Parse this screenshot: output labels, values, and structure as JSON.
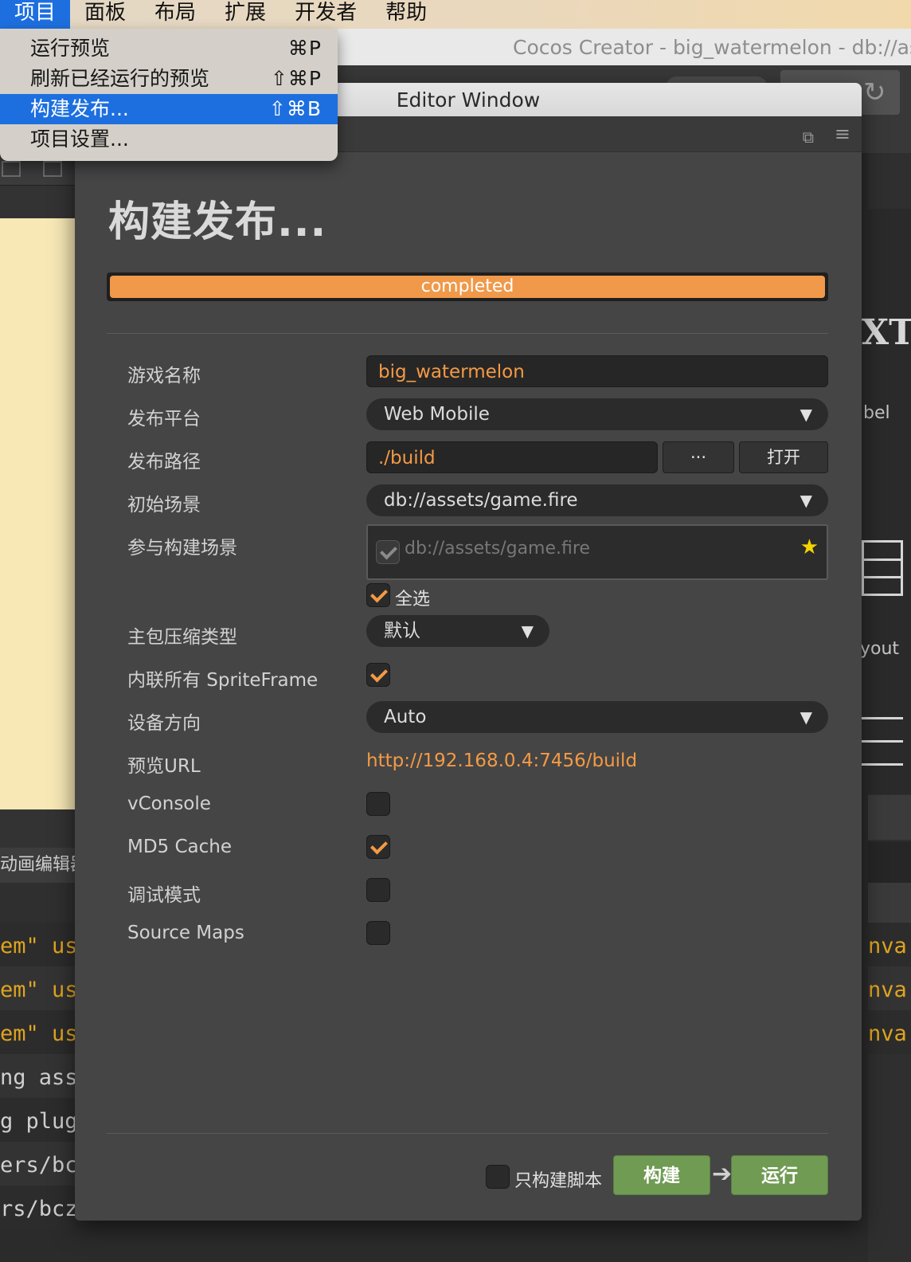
{
  "menubar": {
    "items": [
      "项目",
      "面板",
      "布局",
      "扩展",
      "开发者",
      "帮助"
    ],
    "active_index": 0
  },
  "dropdown": {
    "items": [
      {
        "label": "运行预览",
        "shortcut": "⌘P"
      },
      {
        "label": "刷新已经运行的预览",
        "shortcut": "⇧⌘P"
      },
      {
        "label": "构建发布...",
        "shortcut": "⇧⌘B"
      },
      {
        "label": "项目设置...",
        "shortcut": ""
      }
    ],
    "active_index": 2
  },
  "background": {
    "app_title": "Cocos Creator - big_watermelon - db://as",
    "anim_tab": "动画编辑器",
    "console_left": [
      "em\" us",
      "em\" us",
      "em\" us",
      "ng ass",
      "g plug",
      "ers/bc",
      "rs/bcz"
    ],
    "console_right": [
      "nva",
      "nva",
      "nva"
    ],
    "right_labels": {
      "xt": "XT",
      "label": "bel",
      "layout": "yout"
    }
  },
  "window": {
    "title": "Editor Window",
    "heading": "构建发布...",
    "progress": {
      "label": "completed",
      "percent": 100
    },
    "fields": {
      "game_name": {
        "label": "游戏名称",
        "value": "big_watermelon"
      },
      "platform": {
        "label": "发布平台",
        "value": "Web Mobile"
      },
      "build_path": {
        "label": "发布路径",
        "value": "./build",
        "browse": "···",
        "open": "打开"
      },
      "start_scene": {
        "label": "初始场景",
        "value": "db://assets/game.fire"
      },
      "included_scenes": {
        "label": "参与构建场景",
        "items": [
          "db://assets/game.fire"
        ],
        "select_all": "全选",
        "select_all_checked": true
      },
      "compression": {
        "label": "主包压缩类型",
        "value": "默认"
      },
      "inline_spriteframe": {
        "label": "内联所有 SpriteFrame",
        "checked": true
      },
      "orientation": {
        "label": "设备方向",
        "value": "Auto"
      },
      "preview_url": {
        "label": "预览URL",
        "value": "http://192.168.0.4:7456/build"
      },
      "vconsole": {
        "label": "vConsole",
        "checked": false
      },
      "md5_cache": {
        "label": "MD5 Cache",
        "checked": true
      },
      "debug_mode": {
        "label": "调试模式",
        "checked": false
      },
      "source_maps": {
        "label": "Source Maps",
        "checked": false
      }
    },
    "footer": {
      "scripts_only": {
        "label": "只构建脚本",
        "checked": false
      },
      "build_label": "构建",
      "run_label": "运行"
    }
  },
  "colors": {
    "accent": "#f49a45",
    "menu_highlight": "#1d6fe0",
    "build_green": "#6f9b52"
  }
}
